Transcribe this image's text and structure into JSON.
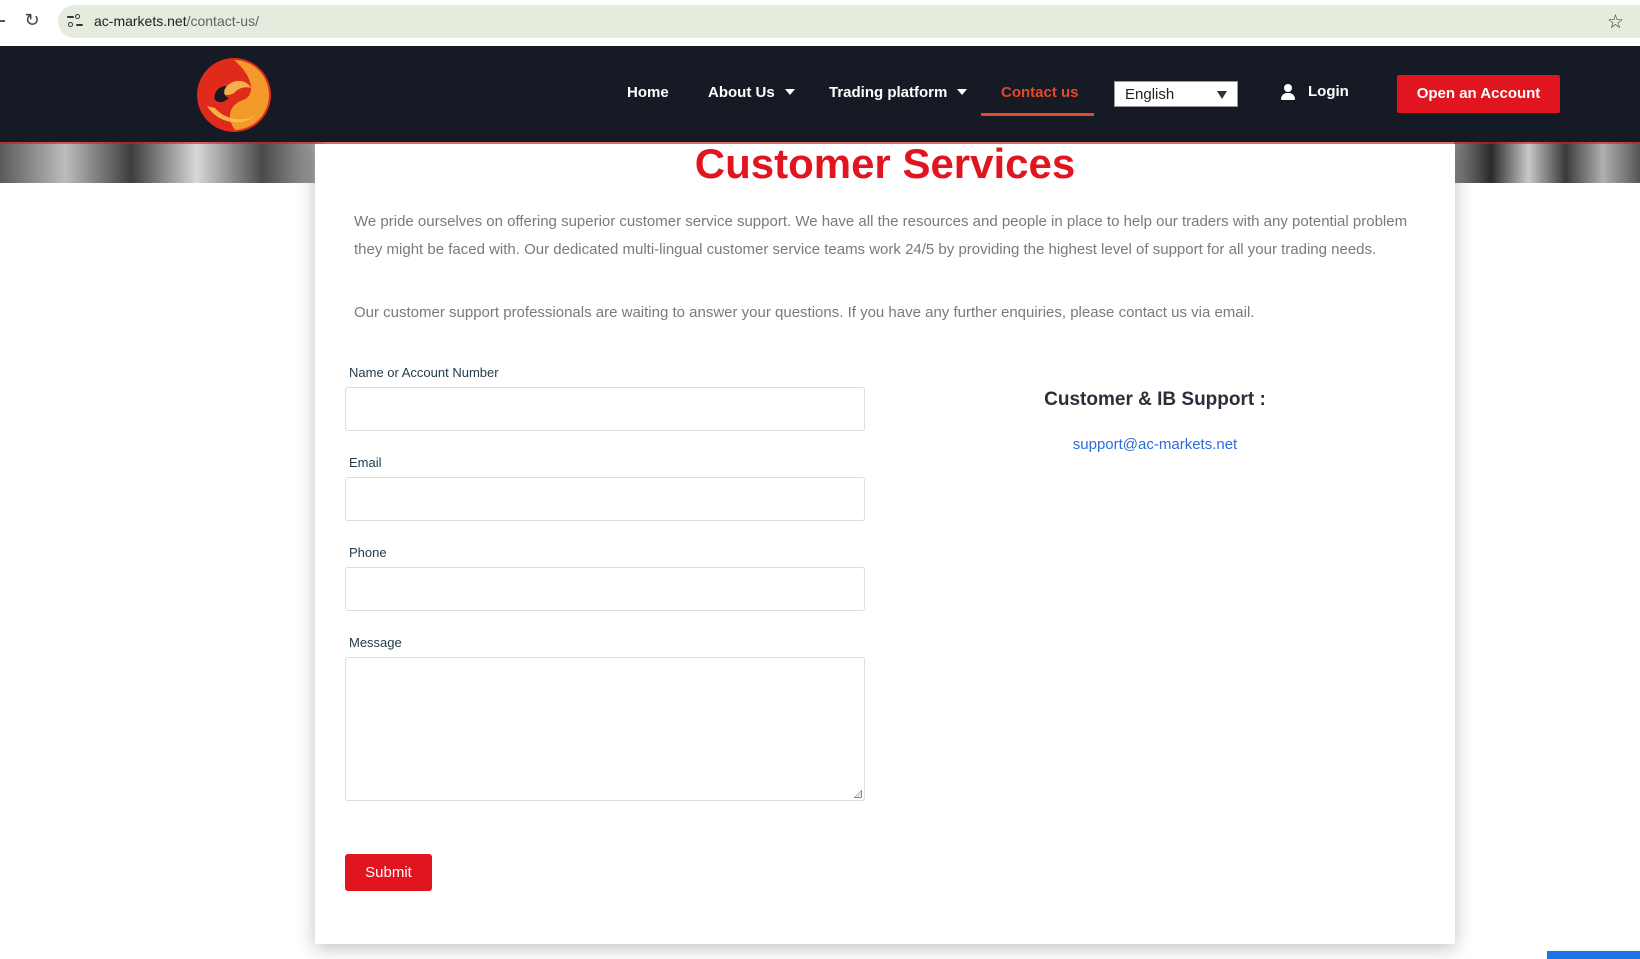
{
  "browser": {
    "url_host": "ac-markets.net",
    "url_path": "/contact-us/"
  },
  "header": {
    "nav": {
      "home": "Home",
      "about": "About Us",
      "trading": "Trading platform",
      "contact": "Contact us"
    },
    "language": "English",
    "login": "Login",
    "open_account": "Open an Account"
  },
  "page": {
    "title": "Customer Services",
    "intro": "We pride ourselves on offering superior customer service support. We have all the resources and people in place to help our traders with any potential problem they might be faced with. Our dedicated multi-lingual customer service teams work 24/5 by providing the highest level of support for all your trading needs.",
    "intro2": "Our customer support professionals are waiting to answer your questions. If you have any further enquiries, please contact us via email."
  },
  "form": {
    "name_label": "Name or Account Number",
    "name_value": "",
    "email_label": "Email",
    "email_value": "",
    "phone_label": "Phone",
    "phone_value": "",
    "message_label": "Message",
    "message_value": "",
    "submit": "Submit"
  },
  "support": {
    "heading": "Customer & IB Support :",
    "email": "support@ac-markets.net"
  },
  "colors": {
    "brand_red": "#e01520",
    "active_nav": "#e8462a",
    "header_bg": "#151a24",
    "link_blue": "#2b6fd6"
  }
}
